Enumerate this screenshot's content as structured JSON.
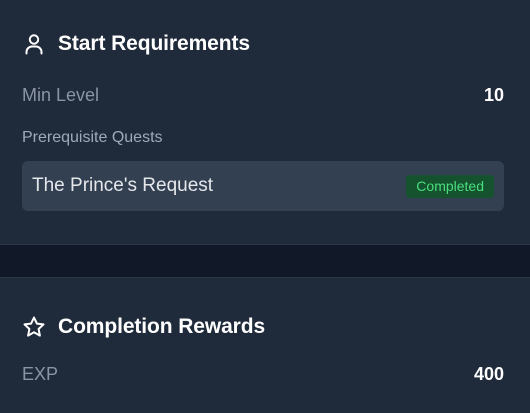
{
  "start_requirements": {
    "title": "Start Requirements",
    "icon": "user-icon",
    "min_level_label": "Min Level",
    "min_level_value": "10",
    "prerequisite_heading": "Prerequisite Quests",
    "prerequisites": [
      {
        "name": "The Prince's Request",
        "status": "Completed"
      }
    ]
  },
  "completion_rewards": {
    "title": "Completion Rewards",
    "icon": "star-icon",
    "exp_label": "EXP",
    "exp_value": "400"
  },
  "colors": {
    "panel_bg": "#1f2a3a",
    "page_bg": "#111827",
    "item_bg": "#334052",
    "badge_bg": "#14532d",
    "badge_text": "#4ade80"
  }
}
